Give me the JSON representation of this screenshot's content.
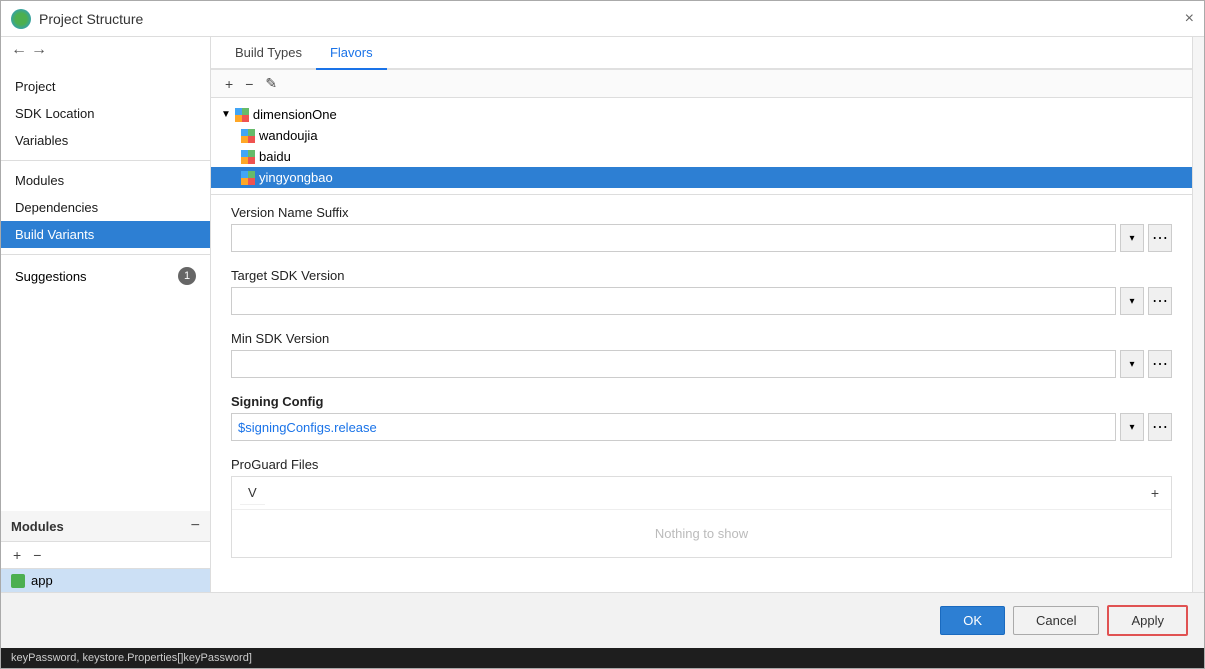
{
  "title_bar": {
    "title": "Project Structure",
    "close_label": "×"
  },
  "nav_arrows": {
    "back": "←",
    "forward": "→"
  },
  "sidebar": {
    "modules_header": "Modules",
    "collapse_btn": "−",
    "add_btn": "+",
    "remove_btn": "−",
    "module_item": "app",
    "nav_items": [
      {
        "label": "Project",
        "active": false
      },
      {
        "label": "SDK Location",
        "active": false
      },
      {
        "label": "Variables",
        "active": false
      },
      {
        "label": "Modules",
        "active": false
      },
      {
        "label": "Dependencies",
        "active": false
      },
      {
        "label": "Build Variants",
        "active": true
      },
      {
        "label": "Suggestions",
        "active": false,
        "badge": "1"
      }
    ]
  },
  "tabs": [
    {
      "label": "Build Types",
      "active": false
    },
    {
      "label": "Flavors",
      "active": true
    }
  ],
  "tree_toolbar": {
    "add": "+",
    "remove": "−",
    "edit": "✎"
  },
  "tree_items": [
    {
      "label": "dimensionOne",
      "level": 0,
      "expanded": true,
      "selected": false
    },
    {
      "label": "wandoujia",
      "level": 1,
      "selected": false
    },
    {
      "label": "baidu",
      "level": 1,
      "selected": false
    },
    {
      "label": "yingyongbao",
      "level": 1,
      "selected": true
    }
  ],
  "form": {
    "version_name_suffix": {
      "label": "Version Name Suffix",
      "value": "",
      "placeholder": ""
    },
    "target_sdk_version": {
      "label": "Target SDK Version",
      "value": "",
      "placeholder": ""
    },
    "min_sdk_version": {
      "label": "Min SDK Version",
      "value": "",
      "placeholder": ""
    },
    "signing_config": {
      "label": "Signing Config",
      "value": "$signingConfigs.release",
      "placeholder": ""
    },
    "proguard_files": {
      "label": "ProGuard Files",
      "value": "V",
      "nothing_to_show": "Nothing to show",
      "add_btn": "+"
    }
  },
  "bottom_buttons": {
    "ok": "OK",
    "cancel": "Cancel",
    "apply": "Apply"
  },
  "code_bar": {
    "text": "keyPassword, keystore.Properties[]keyPassword]"
  }
}
